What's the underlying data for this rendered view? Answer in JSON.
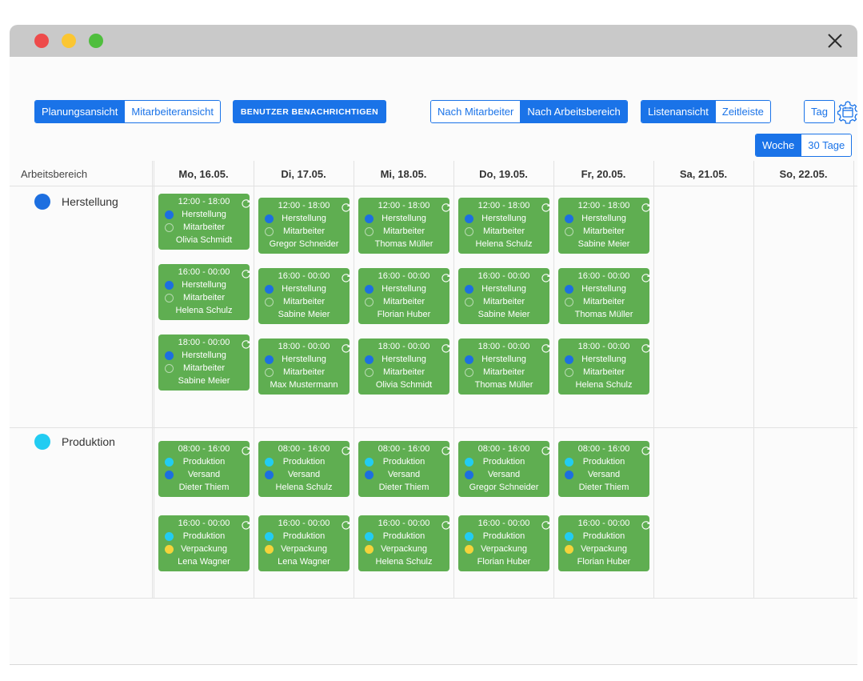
{
  "toolbar": {
    "view_toggle": [
      "Planungsansicht",
      "Mitarbeiteransicht"
    ],
    "notify_label": "BENUTZER BENACHRICHTIGEN",
    "group_toggle": [
      "Nach Mitarbeiter",
      "Nach Arbeitsbereich"
    ],
    "list_toggle": [
      "Listenansicht",
      "Zeitleiste"
    ],
    "day_label": "Tag",
    "range_toggle": [
      "Woche",
      "30 Tage"
    ]
  },
  "colors": {
    "accent": "#1a73e8",
    "shift_card": "#5fae51",
    "herstellung": "#1d6fe0",
    "produktion": "#22ccf2",
    "versand": "#1d6fe0",
    "verpackung": "#f5d33a"
  },
  "grid": {
    "first_header": "Arbeitsbereich",
    "days": [
      "Mo, 16.05.",
      "Di, 17.05.",
      "Mi, 18.05.",
      "Do, 19.05.",
      "Fr, 20.05.",
      "Sa, 21.05.",
      "So, 22.05."
    ]
  },
  "areas": [
    {
      "name": "Herstellung",
      "color": "#1d6fe0",
      "shifts": [
        [
          {
            "time": "12:00 - 18:00",
            "area": "Herstellung",
            "role": "Mitarbeiter",
            "person": "Olivia Schmidt"
          },
          {
            "time": "12:00 - 18:00",
            "area": "Herstellung",
            "role": "Mitarbeiter",
            "person": "Gregor Schneider"
          },
          {
            "time": "12:00 - 18:00",
            "area": "Herstellung",
            "role": "Mitarbeiter",
            "person": "Thomas Müller"
          },
          {
            "time": "12:00 - 18:00",
            "area": "Herstellung",
            "role": "Mitarbeiter",
            "person": "Helena Schulz"
          },
          {
            "time": "12:00 - 18:00",
            "area": "Herstellung",
            "role": "Mitarbeiter",
            "person": "Sabine Meier"
          }
        ],
        [
          {
            "time": "16:00 - 00:00",
            "area": "Herstellung",
            "role": "Mitarbeiter",
            "person": "Helena Schulz"
          },
          {
            "time": "16:00 - 00:00",
            "area": "Herstellung",
            "role": "Mitarbeiter",
            "person": "Sabine Meier"
          },
          {
            "time": "16:00 - 00:00",
            "area": "Herstellung",
            "role": "Mitarbeiter",
            "person": "Florian Huber"
          },
          {
            "time": "16:00 - 00:00",
            "area": "Herstellung",
            "role": "Mitarbeiter",
            "person": "Sabine Meier"
          },
          {
            "time": "16:00 - 00:00",
            "area": "Herstellung",
            "role": "Mitarbeiter",
            "person": "Thomas Müller"
          }
        ],
        [
          {
            "time": "18:00 - 00:00",
            "area": "Herstellung",
            "role": "Mitarbeiter",
            "person": "Sabine Meier"
          },
          {
            "time": "18:00 - 00:00",
            "area": "Herstellung",
            "role": "Mitarbeiter",
            "person": "Max Mustermann"
          },
          {
            "time": "18:00 - 00:00",
            "area": "Herstellung",
            "role": "Mitarbeiter",
            "person": "Olivia Schmidt"
          },
          {
            "time": "18:00 - 00:00",
            "area": "Herstellung",
            "role": "Mitarbeiter",
            "person": "Thomas Müller"
          },
          {
            "time": "18:00 - 00:00",
            "area": "Herstellung",
            "role": "Mitarbeiter",
            "person": "Helena Schulz"
          }
        ]
      ]
    },
    {
      "name": "Produktion",
      "color": "#22ccf2",
      "shifts": [
        [
          {
            "time": "08:00 - 16:00",
            "area": "Produktion",
            "role": "Versand",
            "person": "Dieter Thiem"
          },
          {
            "time": "08:00 - 16:00",
            "area": "Produktion",
            "role": "Versand",
            "person": "Helena Schulz"
          },
          {
            "time": "08:00 - 16:00",
            "area": "Produktion",
            "role": "Versand",
            "person": "Dieter Thiem"
          },
          {
            "time": "08:00 - 16:00",
            "area": "Produktion",
            "role": "Versand",
            "person": "Gregor Schneider"
          },
          {
            "time": "08:00 - 16:00",
            "area": "Produktion",
            "role": "Versand",
            "person": "Dieter Thiem"
          }
        ],
        [
          {
            "time": "16:00 - 00:00",
            "area": "Produktion",
            "role": "Verpackung",
            "person": "Lena Wagner"
          },
          {
            "time": "16:00 - 00:00",
            "area": "Produktion",
            "role": "Verpackung",
            "person": "Lena Wagner"
          },
          {
            "time": "16:00 - 00:00",
            "area": "Produktion",
            "role": "Verpackung",
            "person": "Helena Schulz"
          },
          {
            "time": "16:00 - 00:00",
            "area": "Produktion",
            "role": "Verpackung",
            "person": "Florian Huber"
          },
          {
            "time": "16:00 - 00:00",
            "area": "Produktion",
            "role": "Verpackung",
            "person": "Florian Huber"
          }
        ]
      ]
    }
  ]
}
